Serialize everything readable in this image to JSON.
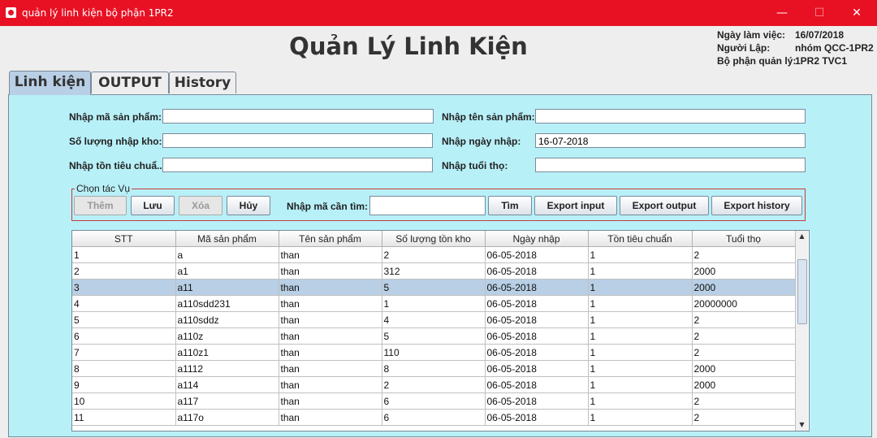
{
  "window": {
    "title": "quản lý linh kiện bộ phận 1PR2",
    "min": "—",
    "max": "☐",
    "close": "✕"
  },
  "heading": "Quản Lý Linh Kiện",
  "info": {
    "date_label": "Ngày làm việc:",
    "date_value": "16/07/2018",
    "author_label": "Người Lập:",
    "author_value": "nhóm QCC-1PR2",
    "dept_label": "Bộ phận quản lý:",
    "dept_value": "1PR2 TVC1"
  },
  "tabs": [
    "Linh kiện",
    "OUTPUT",
    "History"
  ],
  "form": {
    "ma_sp_label": "Nhập mã sản phẩm:",
    "ma_sp_value": "",
    "ten_sp_label": "Nhập tên sản phẩm:",
    "ten_sp_value": "",
    "so_luong_label": "Số lượng nhập kho:",
    "so_luong_value": "",
    "ngay_nhap_label": "Nhập ngày nhập:",
    "ngay_nhap_value": "16-07-2018",
    "ton_label": "Nhập tồn tiêu chuẩ...",
    "ton_value": "",
    "tuoi_tho_label": "Nhập tuổi thọ:",
    "tuoi_tho_value": ""
  },
  "actions": {
    "group_title": "Chọn tác Vụ",
    "them": "Thêm",
    "luu": "Lưu",
    "xoa": "Xóa",
    "huy": "Hủy",
    "search_label": "Nhập mã cần tìm:",
    "search_value": "",
    "tim": "Tìm",
    "export_input": "Export input",
    "export_output": "Export output",
    "export_history": "Export history"
  },
  "table": {
    "columns": [
      "STT",
      "Mã sản phẩm",
      "Tên sản phẩm",
      "Số lượng tồn kho",
      "Ngày nhập",
      "Tồn tiêu chuẩn",
      "Tuổi thọ"
    ],
    "selected_row": 2,
    "rows": [
      [
        "1",
        "a",
        "than",
        "2",
        "06-05-2018",
        "1",
        "2"
      ],
      [
        "2",
        "a1",
        "than",
        "312",
        "06-05-2018",
        "1",
        "2000"
      ],
      [
        "3",
        "a11",
        "than",
        "5",
        "06-05-2018",
        "1",
        "2000"
      ],
      [
        "4",
        "a110sdd231",
        "than",
        "1",
        "06-05-2018",
        "1",
        "20000000"
      ],
      [
        "5",
        "a110sddz",
        "than",
        "4",
        "06-05-2018",
        "1",
        "2"
      ],
      [
        "6",
        "a110z",
        "than",
        "5",
        "06-05-2018",
        "1",
        "2"
      ],
      [
        "7",
        "a110z1",
        "than",
        "110",
        "06-05-2018",
        "1",
        "2"
      ],
      [
        "8",
        "a1112",
        "than",
        "8",
        "06-05-2018",
        "1",
        "2000"
      ],
      [
        "9",
        "a114",
        "than",
        "2",
        "06-05-2018",
        "1",
        "2000"
      ],
      [
        "10",
        "a117",
        "than",
        "6",
        "06-05-2018",
        "1",
        "2"
      ],
      [
        "11",
        "a117o",
        "than",
        "6",
        "06-05-2018",
        "1",
        "2"
      ]
    ]
  }
}
